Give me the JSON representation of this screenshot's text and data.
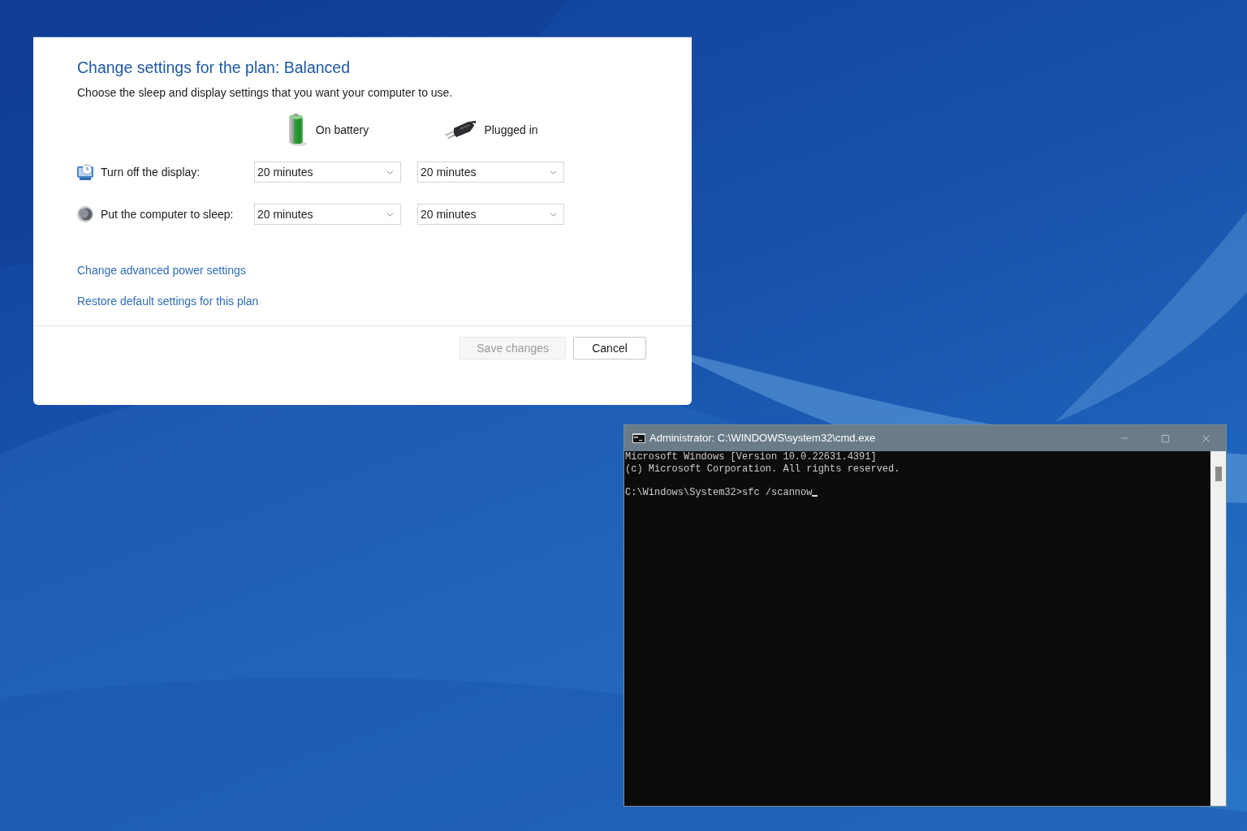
{
  "power_plan_dialog": {
    "title": "Change settings for the plan: Balanced",
    "subtitle": "Choose the sleep and display settings that you want your computer to use.",
    "power_sources": [
      {
        "kind": "battery",
        "label": "On battery"
      },
      {
        "kind": "plug",
        "label": "Plugged in"
      }
    ],
    "settings": [
      {
        "kind": "display",
        "label": "Turn off the display:",
        "values": [
          "20 minutes",
          "20 minutes"
        ]
      },
      {
        "kind": "sleep",
        "label": "Put the computer to sleep:",
        "values": [
          "20 minutes",
          "20 minutes"
        ]
      }
    ],
    "links": [
      "Change advanced power settings",
      "Restore default settings for this plan"
    ],
    "buttons": [
      {
        "label": "Save changes",
        "disabled": true
      },
      {
        "label": "Cancel",
        "disabled": false
      }
    ]
  },
  "console_window": {
    "title": "Administrator: C:\\WINDOWS\\system32\\cmd.exe",
    "output_lines": [
      "Microsoft Windows [Version 10.0.22631.4391]",
      "(c) Microsoft Corporation. All rights reserved."
    ],
    "command_line": "C:\\Windows\\System32>sfc /scannow",
    "cursor_visible": true
  }
}
